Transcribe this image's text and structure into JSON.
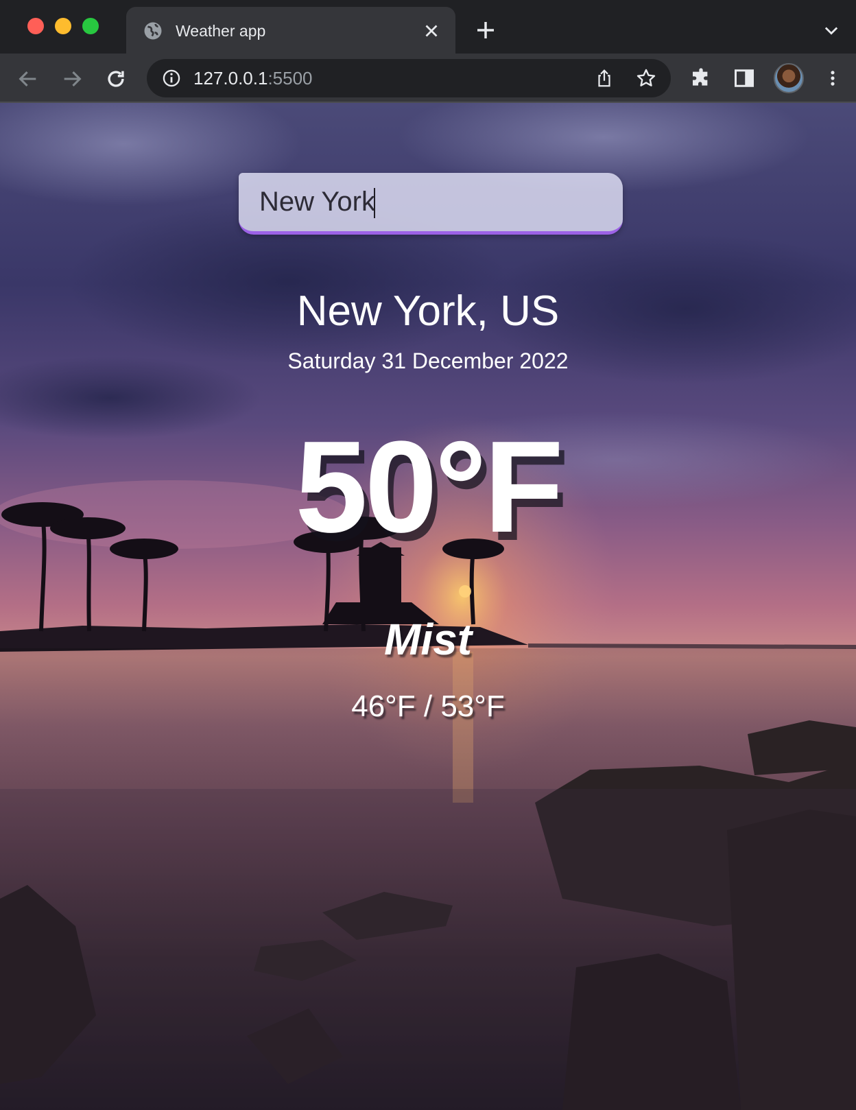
{
  "browser": {
    "tab_title": "Weather app",
    "url_host": "127.0.0.1",
    "url_port": ":5500"
  },
  "weather": {
    "search_value": "New York",
    "location": "New York, US",
    "date": "Saturday 31 December 2022",
    "temperature": "50°F",
    "condition": "Mist",
    "hi_low": "46°F / 53°F"
  },
  "colors": {
    "search_underline": "#9c62e6",
    "browser_frame": "#202124",
    "toolbar": "#35363a"
  },
  "icons": [
    "globe-icon",
    "close-icon",
    "plus-icon",
    "chevron-down-icon",
    "back-arrow-icon",
    "forward-arrow-icon",
    "reload-icon",
    "info-icon",
    "share-icon",
    "star-icon",
    "puzzle-icon",
    "side-panel-icon",
    "kebab-menu-icon"
  ]
}
